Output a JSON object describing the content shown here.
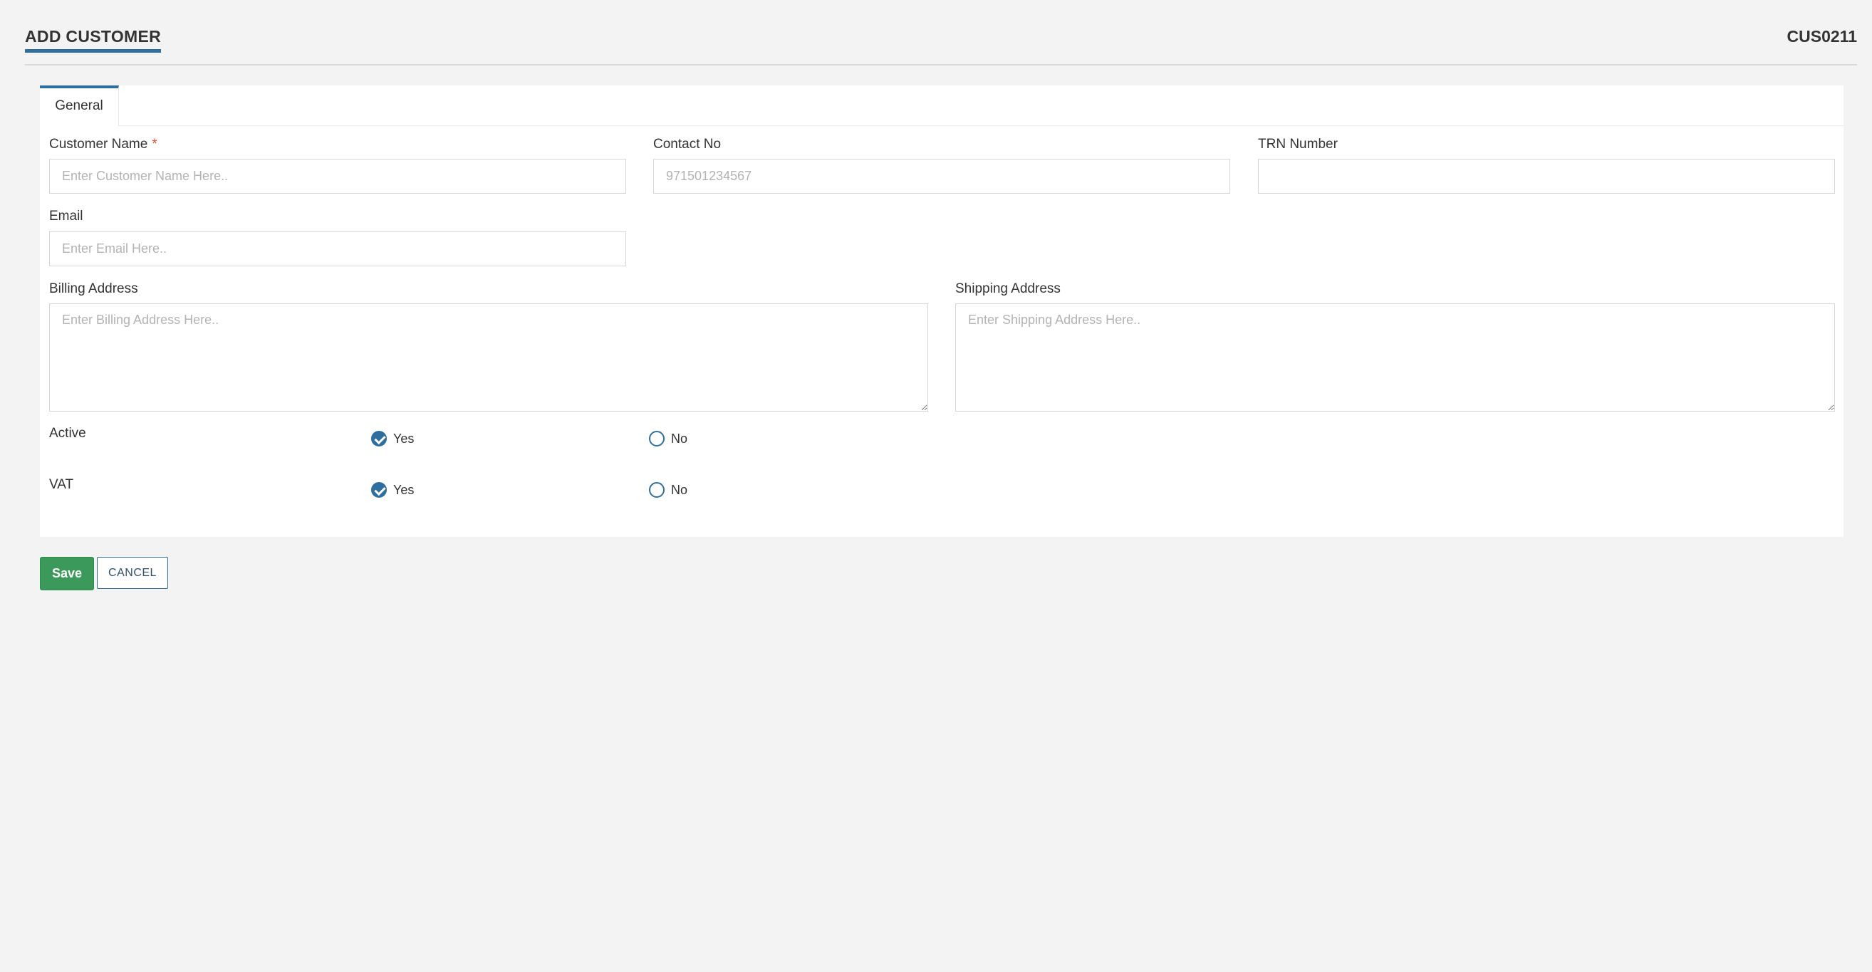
{
  "header": {
    "title": "ADD CUSTOMER",
    "customer_code": "CUS0211"
  },
  "tabs": [
    {
      "label": "General",
      "active": true
    }
  ],
  "form": {
    "customer_name": {
      "label": "Customer Name",
      "required_mark": "*",
      "value": "",
      "placeholder": "Enter Customer Name Here.."
    },
    "contact_no": {
      "label": "Contact No",
      "value": "",
      "placeholder": "971501234567"
    },
    "trn_number": {
      "label": "TRN Number",
      "value": "",
      "placeholder": ""
    },
    "email": {
      "label": "Email",
      "value": "",
      "placeholder": "Enter Email Here.."
    },
    "billing_address": {
      "label": "Billing Address",
      "value": "",
      "placeholder": "Enter Billing Address Here.."
    },
    "shipping_address": {
      "label": "Shipping Address",
      "value": "",
      "placeholder": "Enter Shipping Address Here.."
    },
    "active": {
      "label": "Active",
      "options": [
        "Yes",
        "No"
      ],
      "selected": "Yes"
    },
    "vat": {
      "label": "VAT",
      "options": [
        "Yes",
        "No"
      ],
      "selected": "Yes"
    }
  },
  "actions": {
    "save_label": "Save",
    "cancel_label": "CANCEL"
  },
  "colors": {
    "accent": "#2f6f9f",
    "save_button": "#3b9a5b",
    "required": "#e24c2c",
    "background": "#f3f3f3"
  }
}
